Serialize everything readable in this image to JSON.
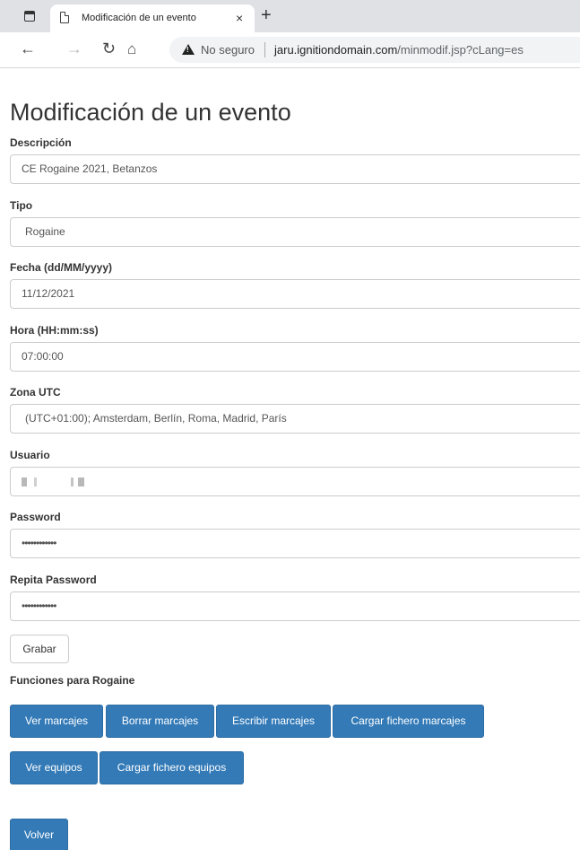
{
  "browser": {
    "tab_title": "Modificación de un evento",
    "tab_close": "×",
    "new_tab": "+",
    "security_label": "No seguro",
    "url_host": "jaru.ignitiondomain.com",
    "url_path": "/minmodif.jsp?cLang=es"
  },
  "page": {
    "title": "Modificación de un evento",
    "fields": {
      "descripcion": {
        "label": "Descripción",
        "value": "CE Rogaine 2021, Betanzos"
      },
      "tipo": {
        "label": "Tipo",
        "value": "Rogaine"
      },
      "fecha": {
        "label": "Fecha (dd/MM/yyyy)",
        "value": "11/12/2021"
      },
      "hora": {
        "label": "Hora (HH:mm:ss)",
        "value": "07:00:00"
      },
      "zona": {
        "label": "Zona UTC",
        "value": "(UTC+01:00); Amsterdam, Berlín, Roma, Madrid, París"
      },
      "usuario": {
        "label": "Usuario",
        "value": ""
      },
      "password": {
        "label": "Password",
        "value": "••••••••••••"
      },
      "password2": {
        "label": "Repita Password",
        "value": "••••••••••••"
      }
    },
    "save_button": "Grabar",
    "functions_heading": "Funciones para Rogaine",
    "buttons": {
      "ver_marcajes": "Ver marcajes",
      "borrar_marcajes": "Borrar marcajes",
      "escribir_marcajes": "Escribir marcajes",
      "cargar_marcajes": "Cargar fichero marcajes",
      "ver_equipos": "Ver equipos",
      "cargar_equipos": "Cargar fichero equipos",
      "volver": "Volver"
    },
    "colors": {
      "primary": "#337ab7",
      "primary_border": "#2e6da4"
    }
  }
}
